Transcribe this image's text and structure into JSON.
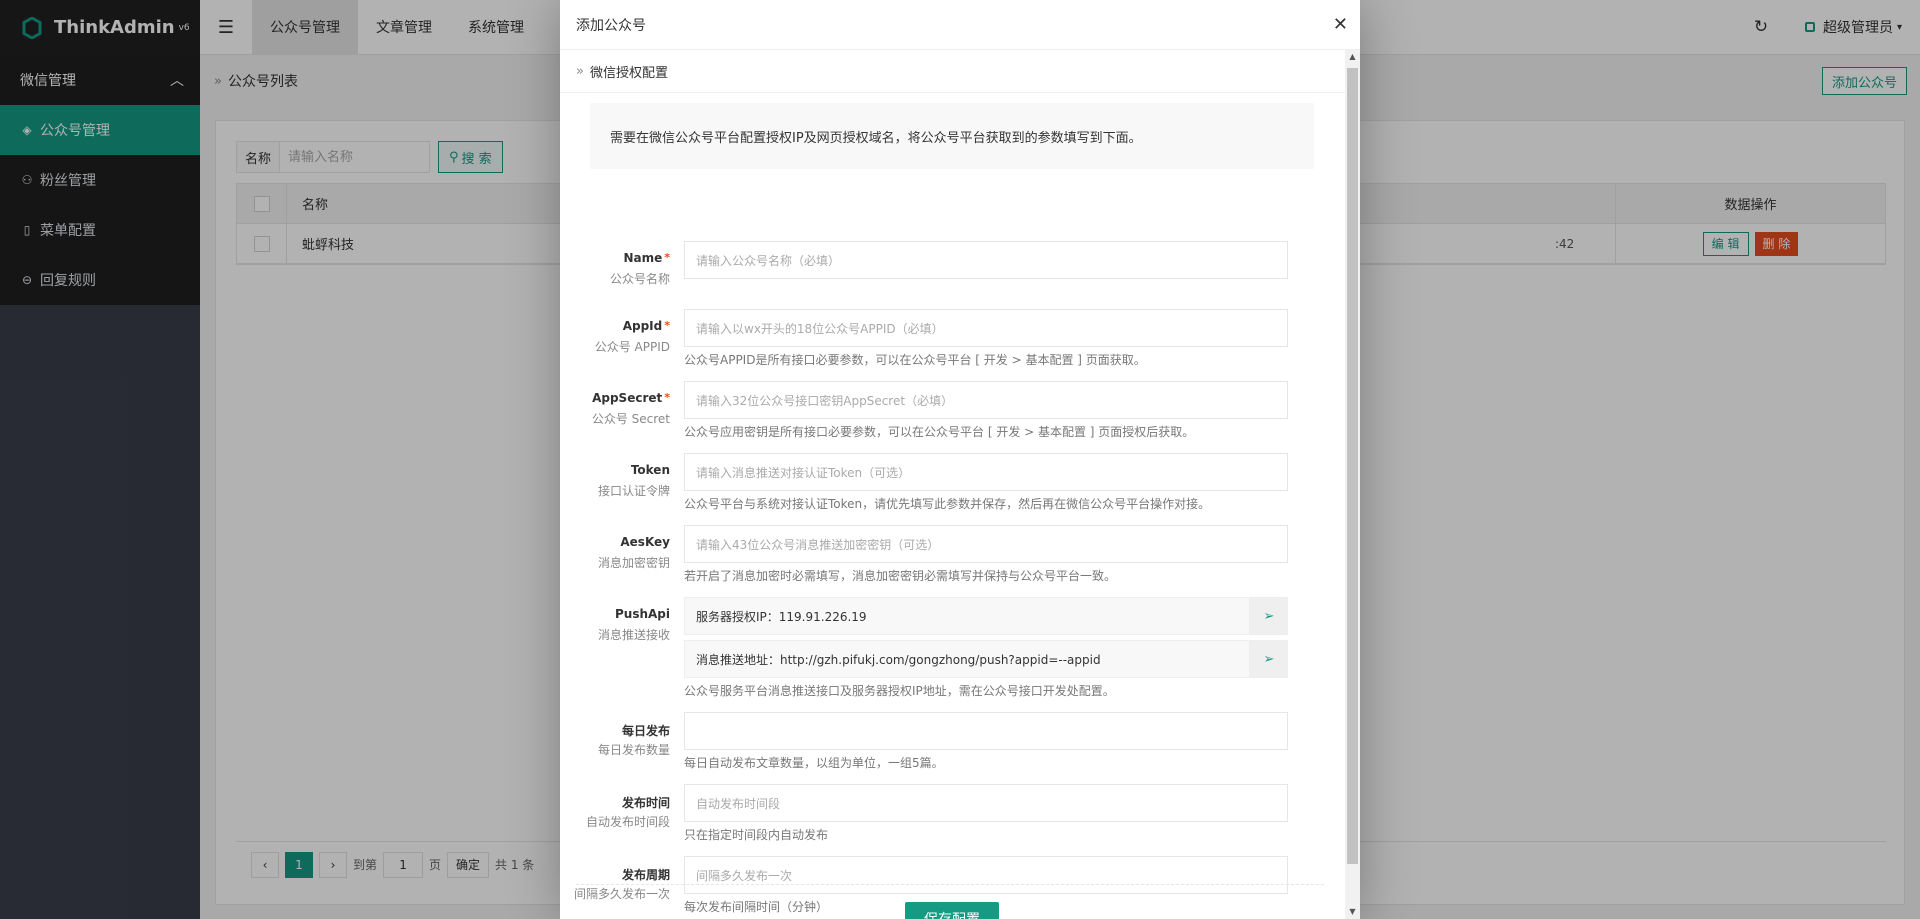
{
  "brand": {
    "name": "ThinkAdmin",
    "version": "v6"
  },
  "sidebar": {
    "group": "微信管理",
    "items": [
      {
        "label": "公众号管理",
        "icon": "layers-icon",
        "active": true
      },
      {
        "label": "粉丝管理",
        "icon": "user-icon",
        "active": false
      },
      {
        "label": "菜单配置",
        "icon": "phone-icon",
        "active": false
      },
      {
        "label": "回复规则",
        "icon": "reply-icon",
        "active": false
      }
    ]
  },
  "topbar": {
    "tabs": [
      "公众号管理",
      "文章管理",
      "系统管理"
    ],
    "user": "超级管理员"
  },
  "page": {
    "breadcrumb": "公众号列表",
    "add_button": "添加公众号",
    "search_label": "名称",
    "search_placeholder": "请输入名称",
    "search_button": "搜 索",
    "table_headers": {
      "name": "名称",
      "ops": "数据操作"
    },
    "rows": [
      {
        "name": "蚍蜉科技",
        "time": ":42",
        "edit": "编 辑",
        "delete": "删 除"
      }
    ],
    "pager": {
      "current": "1",
      "goto": "到第",
      "page_value": "1",
      "page_unit": "页",
      "confirm": "确定",
      "total": "共 1 条"
    }
  },
  "modal": {
    "title": "添加公众号",
    "section": "微信授权配置",
    "notice": "需要在微信公众号平台配置授权IP及网页授权域名，将公众号平台获取到的参数填写到下面。",
    "fields": {
      "name": {
        "label": "Name",
        "sub": "公众号名称",
        "placeholder": "请输入公众号名称（必填）"
      },
      "appid": {
        "label": "AppId",
        "sub": "公众号 APPID",
        "placeholder": "请输入以wx开头的18位公众号APPID（必填）",
        "help": "公众号APPID是所有接口必要参数，可以在公众号平台 [ 开发 > 基本配置 ] 页面获取。"
      },
      "appsecret": {
        "label": "AppSecret",
        "sub": "公众号 Secret",
        "placeholder": "请输入32位公众号接口密钥AppSecret（必填）",
        "help": "公众号应用密钥是所有接口必要参数，可以在公众号平台 [ 开发 > 基本配置 ] 页面授权后获取。"
      },
      "token": {
        "label": "Token",
        "sub": "接口认证令牌",
        "placeholder": "请输入消息推送对接认证Token（可选）",
        "help": "公众号平台与系统对接认证Token，请优先填写此参数并保存，然后再在微信公众号平台操作对接。"
      },
      "aeskey": {
        "label": "AesKey",
        "sub": "消息加密密钥",
        "placeholder": "请输入43位公众号消息推送加密密钥（可选）",
        "help": "若开启了消息加密时必需填写，消息加密密钥必需填写并保持与公众号平台一致。"
      },
      "pushapi": {
        "label": "PushApi",
        "sub": "消息推送接收",
        "ip": "服务器授权IP：119.91.226.19",
        "url": "消息推送地址：http://gzh.pifukj.com/gongzhong/push?appid=--appid",
        "help": "公众号服务平台消息推送接口及服务器授权IP地址，需在公众号接口开发处配置。"
      },
      "daily": {
        "label": "每日发布",
        "sub": "每日发布数量",
        "placeholder": "",
        "help": "每日自动发布文章数量，以组为单位，一组5篇。"
      },
      "time": {
        "label": "发布时间",
        "sub": "自动发布时间段",
        "placeholder": "自动发布时间段",
        "help": "只在指定时间段内自动发布"
      },
      "period": {
        "label": "发布周期",
        "sub": "间隔多久发布一次",
        "placeholder": "间隔多久发布一次",
        "help": "每次发布间隔时间（分钟）"
      }
    },
    "save_button": "保存配置"
  },
  "colors": {
    "accent": "#159a84",
    "danger": "#e54d1f",
    "sidebar": "#393d49"
  }
}
